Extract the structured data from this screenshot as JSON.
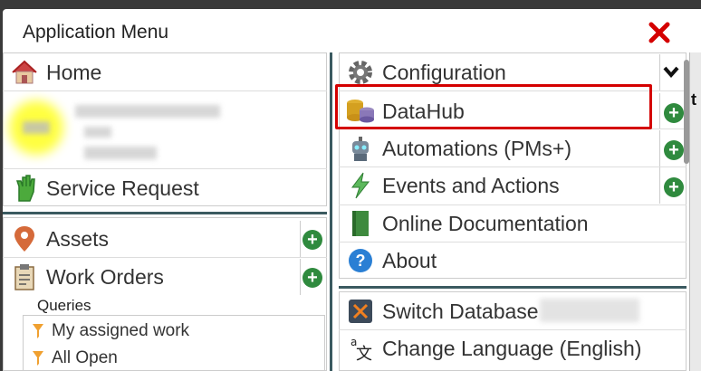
{
  "dialog": {
    "title": "Application Menu"
  },
  "left": {
    "home": "Home",
    "service_request": "Service Request",
    "assets": "Assets",
    "work_orders": "Work Orders",
    "queries_label": "Queries",
    "queries": [
      "My assigned work",
      "All Open"
    ]
  },
  "right": {
    "configuration": "Configuration",
    "datahub": "DataHub",
    "automations": "Automations (PMs+)",
    "events": "Events and Actions",
    "online_docs": "Online Documentation",
    "about": "About",
    "switch_db": "Switch Database",
    "change_lang": "Change Language (English)"
  },
  "edge_glyph": "t",
  "colors": {
    "accent": "#3b5a60",
    "plus": "#2f8a3e",
    "close": "#d40000",
    "highlight": "#d40000"
  }
}
